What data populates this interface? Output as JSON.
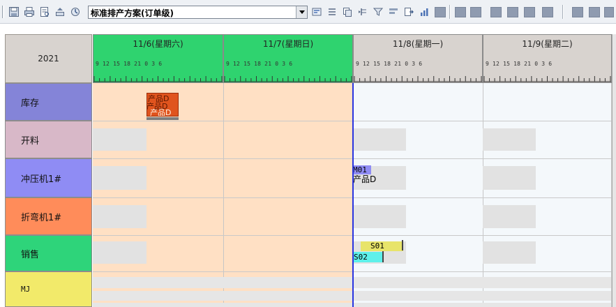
{
  "toolbar": {
    "scheme_select": {
      "value": "标准排产方案(订单级)"
    },
    "left_icons": [
      "save-icon",
      "print-icon",
      "preview-icon",
      "undo-icon"
    ],
    "right_icons": [
      "schedule-icon",
      "list-icon",
      "copy-icon",
      "indent-icon",
      "filter-icon",
      "align-icon",
      "export-icon",
      "chart-icon"
    ]
  },
  "gantt": {
    "year": "2021",
    "days": [
      {
        "label": "11/6(星期六)",
        "hours": "9  12  15  18  21  0   3   6",
        "color": "#2fd36f"
      },
      {
        "label": "11/7(星期日)",
        "hours": "9  12  15  18  21  0   3   6",
        "color": "#2fd36f"
      },
      {
        "label": "11/8(星期一)",
        "hours": "9  12  15  18  21  0   3   6",
        "color": "#d8d3cf"
      },
      {
        "label": "11/9(星期二)",
        "hours": "9  12  15  18  21  0   3   6",
        "color": "#d8d3cf"
      }
    ],
    "rows": [
      {
        "label": "库存",
        "color": "#8484d8"
      },
      {
        "label": "开料",
        "color": "#d8b8c8"
      },
      {
        "label": "冲压机1#",
        "color": "#8f8cf4"
      },
      {
        "label": "折弯机1#",
        "color": "#ff8c5a"
      },
      {
        "label": "销售",
        "color": "#2ed47a"
      },
      {
        "label": "MJ",
        "color": "#f2ea6a"
      }
    ],
    "inventory_chip": {
      "text_1": "产品D",
      "text_2": "产品D"
    },
    "tasks": {
      "m01_code": "M01",
      "m01_product": "产品D",
      "s01": "S01",
      "s02": "S02"
    }
  }
}
